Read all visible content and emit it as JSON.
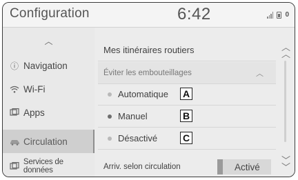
{
  "header": {
    "title": "Configuration",
    "time": "6:42",
    "status_badge": "0"
  },
  "sidebar": {
    "items": [
      {
        "label": "Navigation",
        "icon": "info-icon"
      },
      {
        "label": "Wi-Fi",
        "icon": "wifi-icon"
      },
      {
        "label": "Apps",
        "icon": "apps-icon"
      },
      {
        "label": "Circulation",
        "icon": "car-icon",
        "active": true
      },
      {
        "label": "Services de données",
        "icon": "data-services-icon"
      }
    ]
  },
  "main": {
    "section_title": "Mes itinéraires routiers",
    "subheader": "Éviter les embouteillages",
    "options": [
      {
        "label": "Automatique",
        "marker": "A",
        "selected": false
      },
      {
        "label": "Manuel",
        "marker": "B",
        "selected": true
      },
      {
        "label": "Désactivé",
        "marker": "C",
        "selected": false
      }
    ],
    "bottom_row": {
      "label": "Arriv. selon circulation",
      "toggle_value": "Activé"
    }
  }
}
